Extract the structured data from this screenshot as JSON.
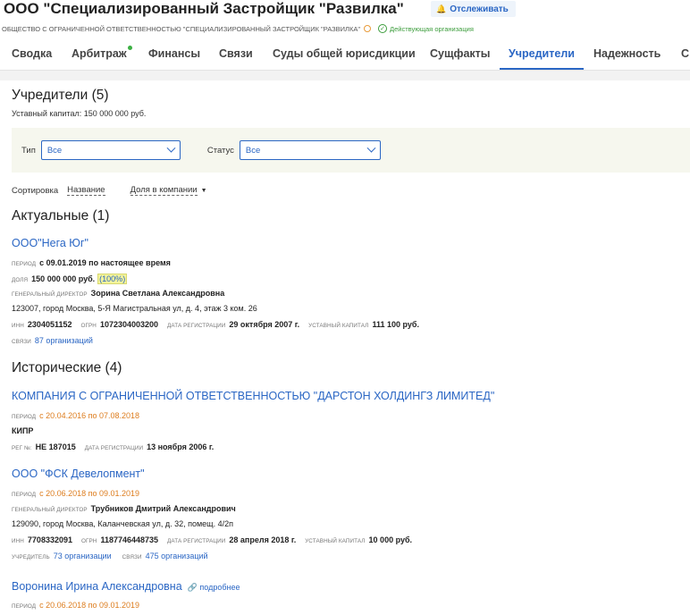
{
  "header": {
    "title": "ООО \"Специализированный Застройщик \"Развилка\"",
    "follow_label": "Отслеживать",
    "full_name": "ОБЩЕСТВО С ОГРАНИЧЕННОЙ ОТВЕТСТВЕННОСТЬЮ \"СПЕЦИАЛИЗИРОВАННЫЙ ЗАСТРОЙЩИК \"РАЗВИЛКА\"",
    "status": "Действующая организация"
  },
  "tabs": [
    "Сводка",
    "Арбитраж",
    "Финансы",
    "Связи",
    "Суды общей юрисдикции",
    "Сущфакты",
    "Учредители",
    "Надежность",
    "С"
  ],
  "main": {
    "title": "Учредители (5)",
    "capital": "Уставный капитал: 150 000 000 руб.",
    "filters": {
      "type_label": "Тип",
      "type_value": "Все",
      "status_label": "Статус",
      "status_value": "Все"
    },
    "sort": {
      "label": "Сортировка",
      "by_name": "Название",
      "by_share": "Доля в компании"
    },
    "current_title": "Актуальные (1)",
    "historic_title": "Исторические (4)"
  },
  "current": [
    {
      "name": "ООО\"Нега Юг\"",
      "period_cap": "период",
      "period": "с 09.01.2019 по настоящее время",
      "share_cap": "доля",
      "share": "150 000 000 руб.",
      "share_pct": "(100%)",
      "director_cap": "генеральный директор",
      "director": "Зорина Светлана Александровна",
      "address": "123007, город Москва, 5-Я Магистральная ул, д. 4, этаж 3 ком. 26",
      "inn_cap": "инн",
      "inn": "2304051152",
      "ogrn_cap": "огрн",
      "ogrn": "1072304003200",
      "reg_cap": "дата регистрации",
      "reg": "29 октября 2007 г.",
      "capital_cap": "уставный капитал",
      "capital": "111 100 руб.",
      "links_cap": "связи",
      "links": "87 организаций"
    }
  ],
  "historic": [
    {
      "name": "КОМПАНИЯ С ОГРАНИЧЕННОЙ ОТВЕТСТВЕННОСТЬЮ \"ДАРСТОН ХОЛДИНГЗ ЛИМИТЕД\"",
      "period_cap": "период",
      "period": "с 20.04.2016 по 07.08.2018",
      "country": "КИПР",
      "regno_cap": "рег №:",
      "regno": "НЕ 187015",
      "reg_cap": "дата регистрации",
      "reg": "13 ноября 2006 г."
    },
    {
      "name": "ООО \"ФСК Девелопмент\"",
      "period_cap": "период",
      "period": "с 20.06.2018 по 09.01.2019",
      "director_cap": "генеральный директор",
      "director": "Трубников Дмитрий Александрович",
      "address": "129090, город Москва, Каланчевская ул, д. 32, помещ. 4/2п",
      "inn_cap": "инн",
      "inn": "7708332091",
      "ogrn_cap": "огрн",
      "ogrn": "1187746448735",
      "reg_cap": "дата регистрации",
      "reg": "28 апреля 2018 г.",
      "capital_cap": "уставный капитал",
      "capital": "10 000 руб.",
      "founder_cap": "учредитель",
      "founder": "73 организации",
      "links_cap": "связи",
      "links": "475 организаций"
    },
    {
      "name": "Воронина Ирина Александровна",
      "more": "подробнее",
      "period_cap": "период",
      "period": "с 20.06.2018 по 09.01.2019"
    }
  ]
}
